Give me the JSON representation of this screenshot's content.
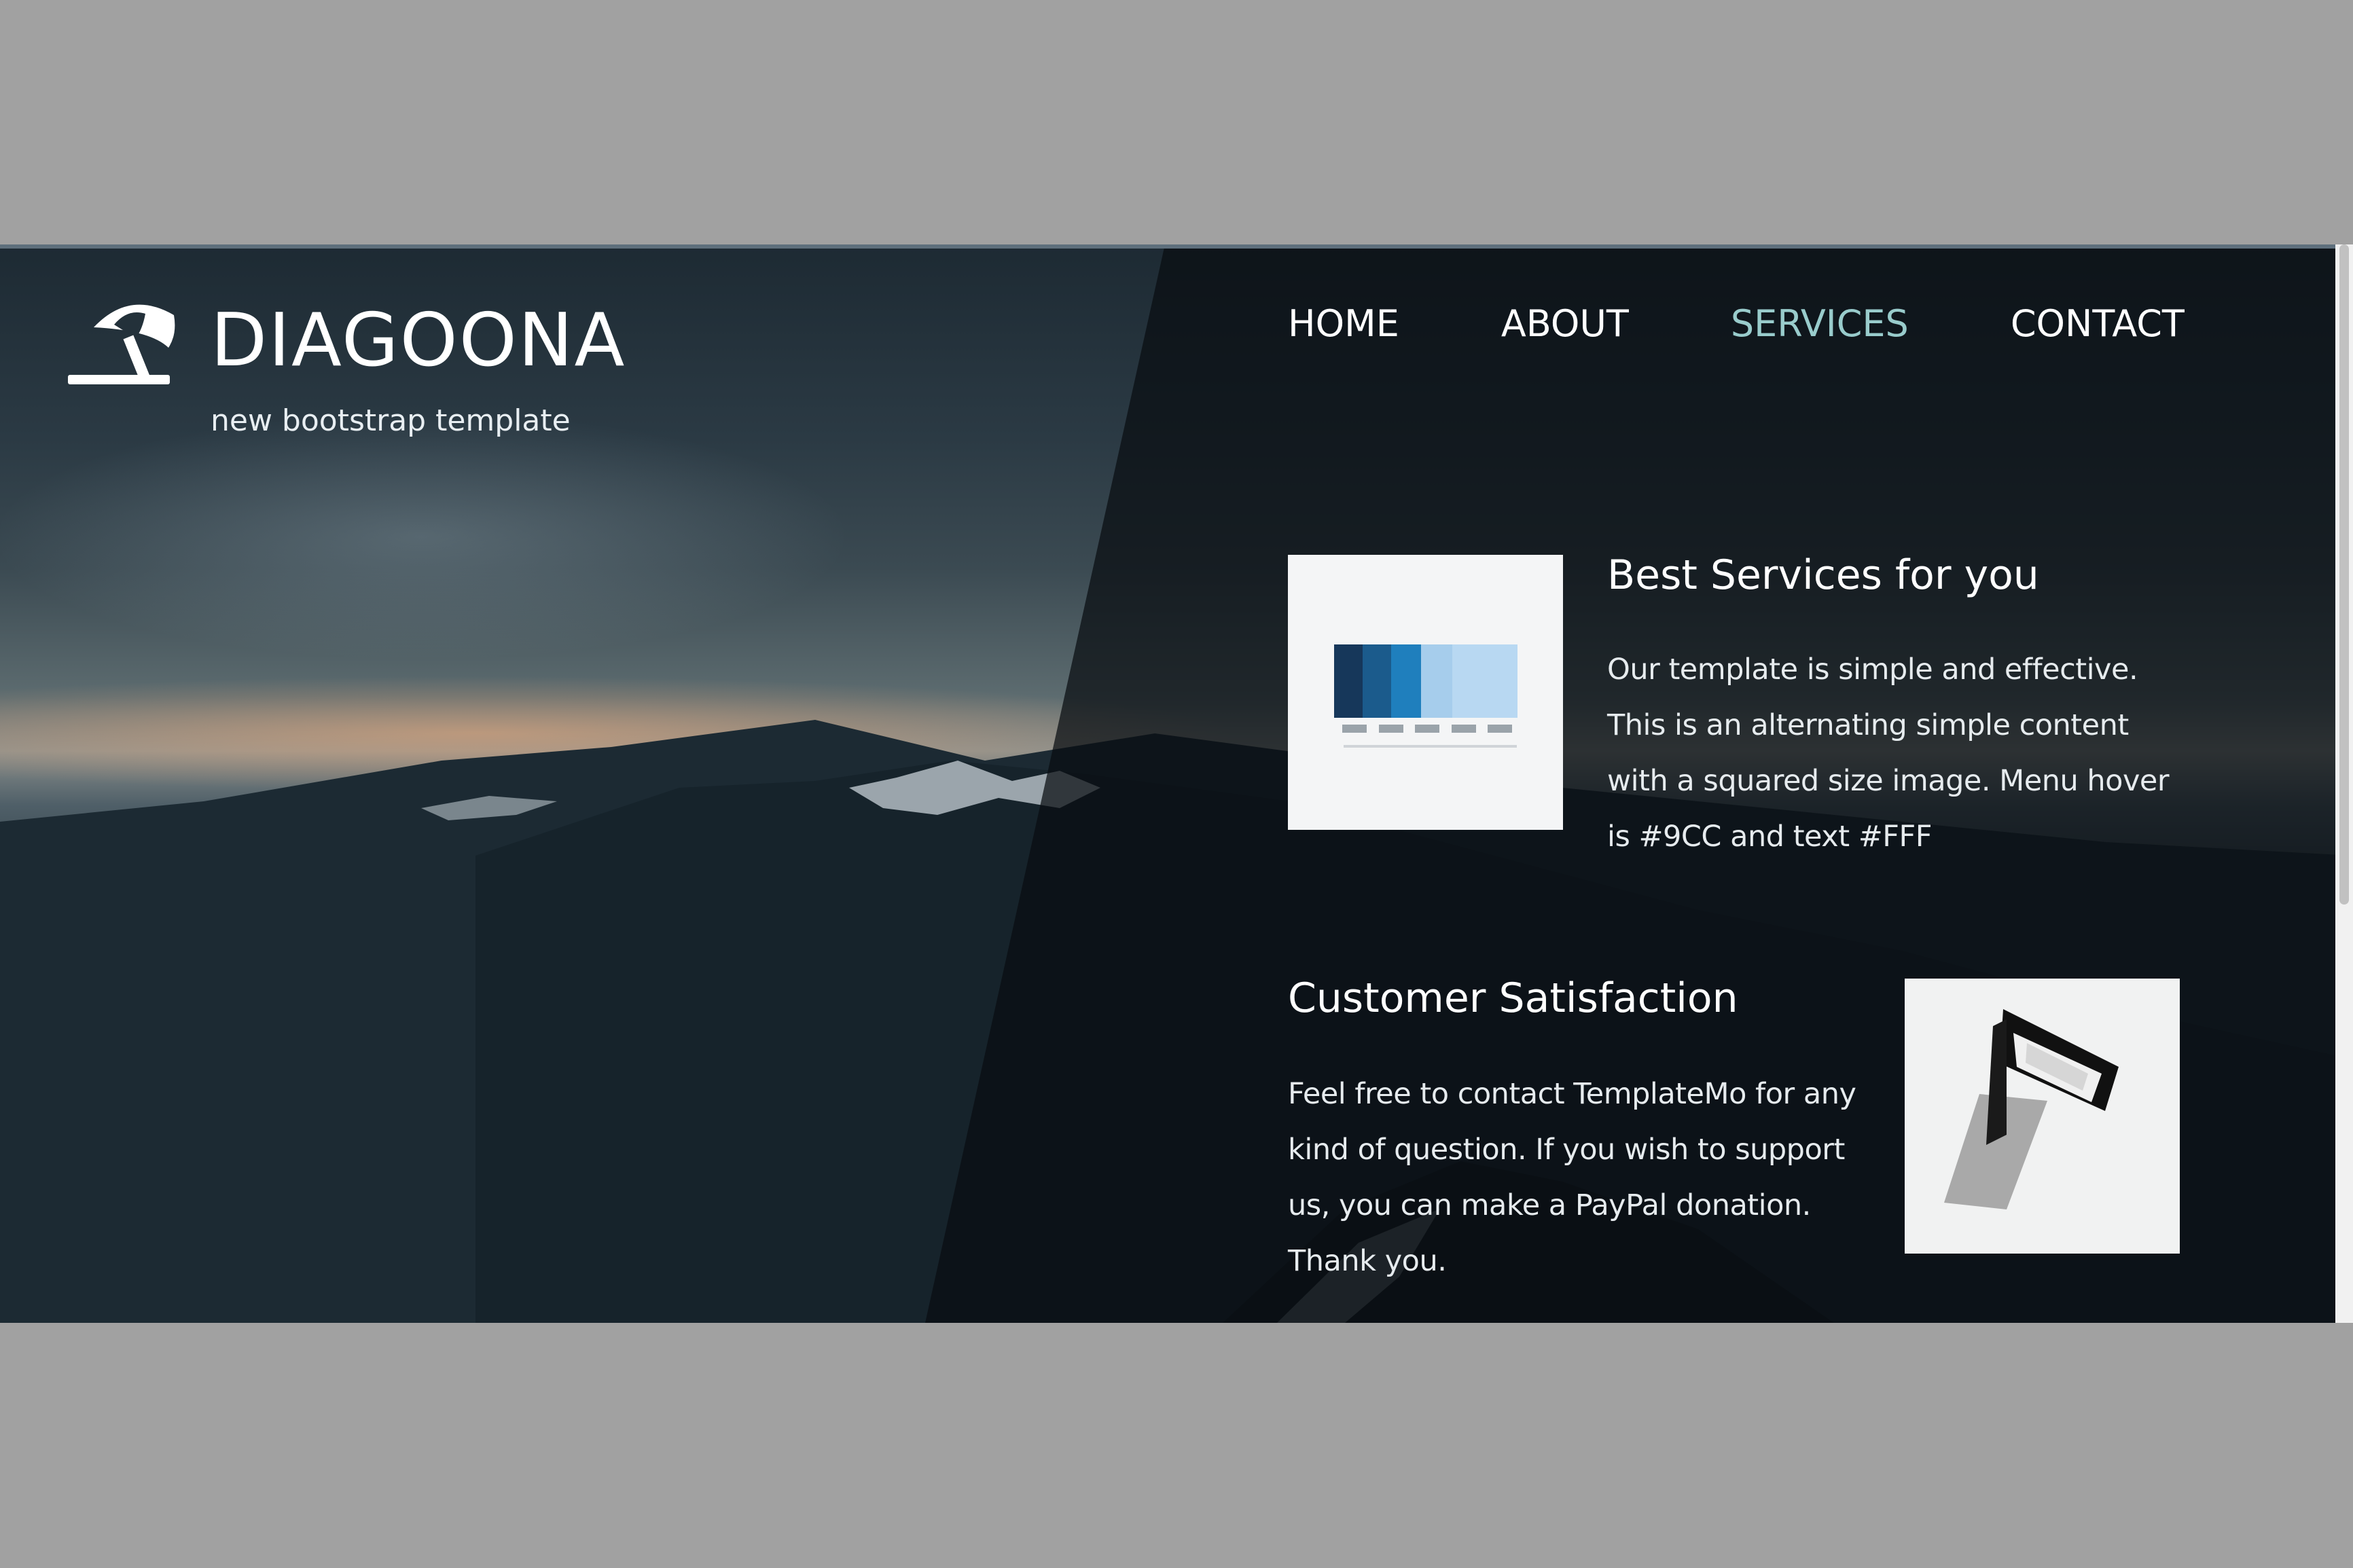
{
  "brand": {
    "title": "DIAGOONA",
    "subtitle": "new bootstrap template",
    "icon": "beach-umbrella-icon"
  },
  "nav": {
    "items": [
      {
        "label": "HOME"
      },
      {
        "label": "ABOUT"
      },
      {
        "label": "SERVICES",
        "active": true
      },
      {
        "label": "CONTACT"
      }
    ],
    "active_color": "#9CC",
    "text_color": "#FFFFFF"
  },
  "services": [
    {
      "title": "Best Services for you",
      "text": "Our template is simple and effective. This is an alternating simple content with a squared size image. Menu hover is #9CC and text #FFF",
      "image": "pantone-swatches-image"
    },
    {
      "title": "Customer Satisfaction",
      "text": "Feel free to contact TemplateMo for any kind of question. If you wish to support us, you can make a PayPal donation. Thank you.",
      "image": "black-frame-card-image"
    }
  ],
  "colors": {
    "page_background": "#A1A1A1",
    "swatches": [
      "#16375a",
      "#1b5b8c",
      "#1f7fbd",
      "#a6cdec",
      "#b8d8f2"
    ]
  }
}
